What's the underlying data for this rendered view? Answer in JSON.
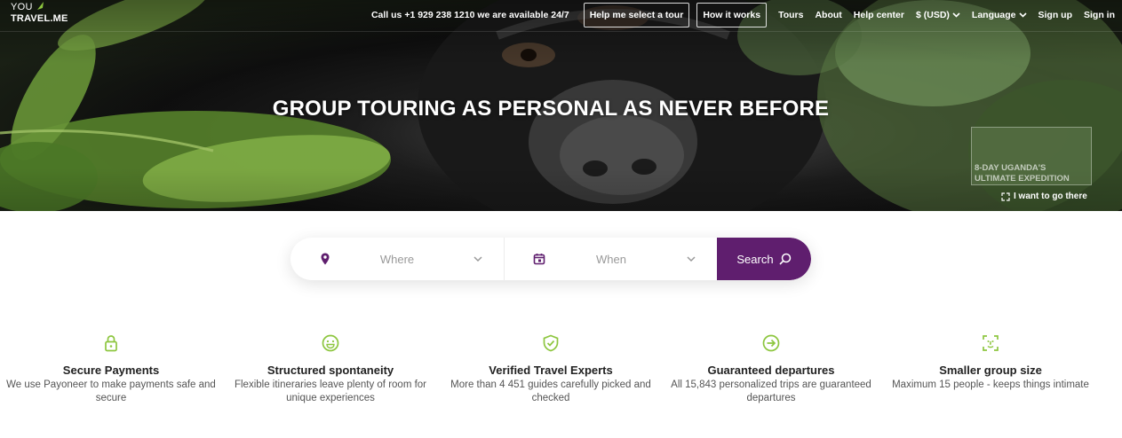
{
  "brand": {
    "line1": "YOU",
    "line2": "TRAVEL.ME",
    "accent": "#8dc63f"
  },
  "nav": {
    "call_text": "Call us +1 929 238 1210 we are available 24/7",
    "help_select": "Help me select a tour",
    "how_it_works": "How it works",
    "tours": "Tours",
    "about": "About",
    "help_center": "Help center",
    "currency": "$ (USD)",
    "language": "Language",
    "sign_up": "Sign up",
    "sign_in": "Sign in"
  },
  "hero": {
    "title": "GROUP TOURING AS PERSONAL AS NEVER BEFORE",
    "promo_line1": "8-DAY UGANDA'S",
    "promo_line2": "ULTIMATE EXPEDITION",
    "promo_link": "I want to go there"
  },
  "search": {
    "where_placeholder": "Where",
    "when_placeholder": "When",
    "button_label": "Search",
    "button_color": "#5f1e6e",
    "icon_color": "#5f1e6e"
  },
  "features": [
    {
      "icon": "lock-icon",
      "title": "Secure Payments",
      "desc": "We use Payoneer to make payments safe and secure"
    },
    {
      "icon": "smile-icon",
      "title": "Structured spontaneity",
      "desc": "Flexible itineraries leave plenty of room for unique experiences"
    },
    {
      "icon": "shield-check-icon",
      "title": "Verified Travel Experts",
      "desc": "More than 4 451 guides carefully picked and checked"
    },
    {
      "icon": "arrow-circle-icon",
      "title": "Guaranteed departures",
      "desc": "All 15,843 personalized trips are guaranteed departures"
    },
    {
      "icon": "face-scan-icon",
      "title": "Smaller group size",
      "desc": "Maximum 15 people - keeps things intimate"
    }
  ],
  "feature_icon_color": "#8dc63f"
}
